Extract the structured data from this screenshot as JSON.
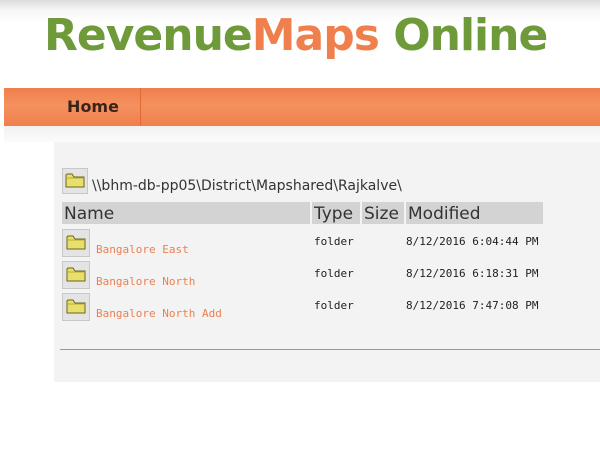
{
  "header": {
    "logo": {
      "part1": "Revenue",
      "part2": "Maps",
      "part3": " Online"
    },
    "colors": {
      "green": "#6e9a3a",
      "orange": "#ef7f4d"
    }
  },
  "nav": {
    "home_label": "Home"
  },
  "browser": {
    "current_path": "\\\\bhm-db-pp05\\District\\Mapshared\\Rajkalve\\",
    "path_icon": "folder-icon",
    "columns": {
      "name": "Name",
      "type": "Type",
      "size": "Size",
      "modified": "Modified"
    },
    "rows": [
      {
        "name": "Bangalore East",
        "type": "folder",
        "size": "",
        "modified": "8/12/2016 6:04:44 PM",
        "icon": "folder-icon"
      },
      {
        "name": "Bangalore North",
        "type": "folder",
        "size": "",
        "modified": "8/12/2016 6:18:31 PM",
        "icon": "folder-icon"
      },
      {
        "name": "Bangalore North Add",
        "type": "folder",
        "size": "",
        "modified": "8/12/2016 7:47:08 PM",
        "icon": "folder-icon"
      }
    ]
  }
}
